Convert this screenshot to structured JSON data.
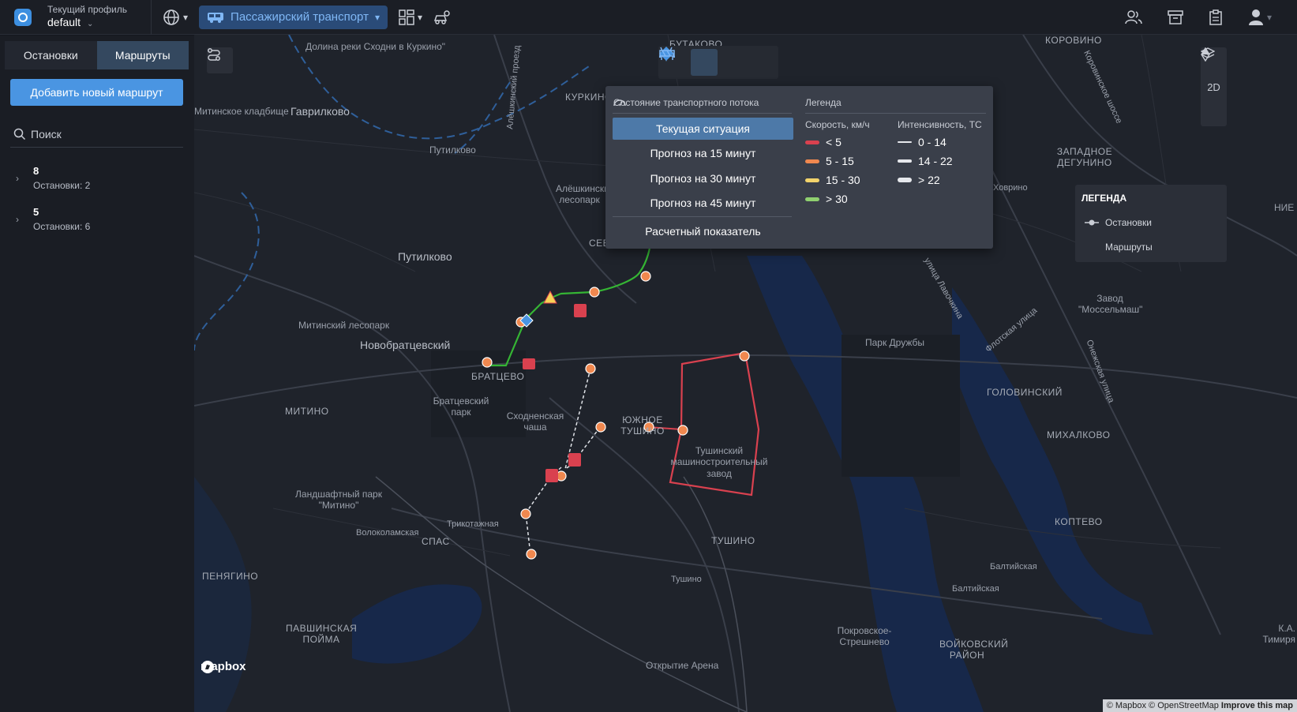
{
  "header": {
    "profile_label": "Текущий профиль",
    "profile_value": "default",
    "transport_label": "Пассажирский транспорт"
  },
  "sidebar": {
    "tabs": [
      {
        "label": "Остановки",
        "active": false
      },
      {
        "label": "Маршруты",
        "active": true
      }
    ],
    "add_button": "Добавить новый маршрут",
    "search_placeholder": "Поиск",
    "routes": [
      {
        "name": "8",
        "sub": "Остановки: 2"
      },
      {
        "name": "5",
        "sub": "Остановки: 6"
      }
    ]
  },
  "map": {
    "controls": {
      "mode_2d": "2D"
    },
    "traffic_panel": {
      "title": "Состояние транспортного потока",
      "options": [
        "Текущая ситуация",
        "Прогноз на 15 минут",
        "Прогноз на 30 минут",
        "Прогноз на 45 минут"
      ],
      "active_option": 0,
      "computed": "Расчетный показатель",
      "legend_title": "Легенда",
      "speed_header": "Скорость, км/ч",
      "intensity_header": "Интенсивность, ТС",
      "speed": [
        {
          "label": "< 5",
          "color": "#d9414f"
        },
        {
          "label": "5 - 15",
          "color": "#f0884f"
        },
        {
          "label": "15 - 30",
          "color": "#f2d36b"
        },
        {
          "label": "> 30",
          "color": "#8fd06f"
        }
      ],
      "intensity": [
        "0 - 14",
        "14 - 22",
        "> 22"
      ]
    },
    "legend": {
      "title": "ЛЕГЕНДА",
      "stops": "Остановки",
      "routes": "Маршруты"
    },
    "labels": [
      "Долина реки Сходни в Куркино\"",
      "БУТАКОВО",
      "КУРКИНО",
      "НОВОБРАТЦЕВСКИЙ",
      "Гаврилково",
      "Путилково",
      "Путилково",
      "Митинский лесопарк",
      "Новобратцевский",
      "БРАТЦЕВО",
      "Братцевский парк",
      "Сходненская чаша",
      "МИТИНО",
      "Ландшафтный парк \"Митино\"",
      "Трикотажная",
      "Волоколамская",
      "СПАС",
      "ПЕНЯГИНО",
      "ПАВШИНСКАЯ ПОЙМА",
      "Открытие Арена",
      "ТУШИНО",
      "Тушино",
      "ЮЖНОЕ ТУШИНО",
      "Тушинский машиностроительный завод",
      "Алёшкинский лесопарк",
      "СЕВЕРНОЕ ТУШИНО",
      "Парк Дружбы",
      "ГОЛОВИНСКИЙ",
      "МИХАЛКОВО",
      "КОПТЕВО",
      "Завод \"Моссельмаш\"",
      "ЗАПАДНОЕ ДЕГУНИНО",
      "Ховрино",
      "Флотская улица",
      "улица Лавочкина",
      "Онежская улица",
      "Балтийская",
      "Балтийская",
      "Покровское-Стрешнево",
      "ВОЙКОВСКИЙ РАЙОН",
      "КОРОВИНО",
      "улица",
      "Митинское кладбище",
      "К.А. Тимиря",
      "НИЕ",
      "Коровинское шоссе",
      "Алёшкинский проезд"
    ],
    "mapbox": "mapbox",
    "attribution": "© Mapbox © OpenStreetMap",
    "improve": "Improve this map"
  }
}
